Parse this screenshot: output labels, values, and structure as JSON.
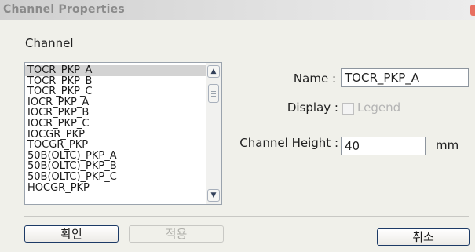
{
  "window": {
    "title": "Channel Properties"
  },
  "channel_section": {
    "label": "Channel"
  },
  "channel_list": {
    "items": [
      "TOCR_PKP_A",
      "TOCR_PKP_B",
      "TOCR_PKP_C",
      "IOCR_PKP_A",
      "IOCR_PKP_B",
      "IOCR_PKP_C",
      "IOCGR_PKP",
      "TOCGR_PKP",
      "50B(OLTC)_PKP_A",
      "50B(OLTC)_PKP_B",
      "50B(OLTC)_PKP_C",
      "HOCGR_PKP"
    ],
    "selected": "TOCR_PKP_A",
    "scrollbar": {
      "up_icon": "▲",
      "down_icon": "▼"
    }
  },
  "form": {
    "name_label": "Name :",
    "name_value": "TOCR_PKP_A",
    "display_label": "Display :",
    "legend_label": "Legend",
    "legend_checked": false,
    "height_label": "Channel Height :",
    "height_value": "40",
    "height_unit": "mm"
  },
  "buttons": {
    "ok": "확인",
    "apply": "적용",
    "cancel": "취소"
  },
  "colors": {
    "dialog_bg": "#f0f0ea",
    "selection": "#d3d3d3",
    "button_border": "#1c3a66",
    "disabled_text": "#b4b4b4"
  }
}
